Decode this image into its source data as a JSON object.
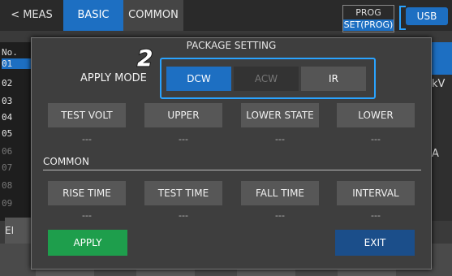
{
  "topbar": {
    "meas_label": "< MEAS",
    "basic_label": "BASIC",
    "common_label": "COMMON",
    "prog_label": "PROG",
    "set_label": "SET(PROG)",
    "usb_label": "USB"
  },
  "background": {
    "no_header": "No.",
    "rows": [
      "01",
      "02",
      "03",
      "04",
      "05",
      "06",
      "07",
      "08",
      "09"
    ],
    "kv_unit": "kV",
    "a_unit": "A",
    "el_label": "EI"
  },
  "dialog": {
    "title": "PACKAGE SETTING",
    "step_number": "2",
    "apply_mode_label": "APPLY MODE",
    "modes": [
      {
        "label": "DCW",
        "selected": true,
        "enabled": true
      },
      {
        "label": "ACW",
        "selected": false,
        "enabled": false
      },
      {
        "label": "IR",
        "selected": false,
        "enabled": true
      }
    ],
    "row1": [
      {
        "label": "TEST VOLT",
        "value": "---"
      },
      {
        "label": "UPPER",
        "value": "---"
      },
      {
        "label": "LOWER STATE",
        "value": "---"
      },
      {
        "label": "LOWER",
        "value": "---"
      }
    ],
    "common_section_label": "COMMON",
    "row2": [
      {
        "label": "RISE TIME",
        "value": "---"
      },
      {
        "label": "TEST TIME",
        "value": "---"
      },
      {
        "label": "FALL TIME",
        "value": "---"
      },
      {
        "label": "INTERVAL",
        "value": "---"
      }
    ],
    "apply_label": "APPLY",
    "exit_label": "EXIT"
  },
  "colors": {
    "accent": "#1d6fc2",
    "highlight": "#2aa3ff",
    "apply": "#1e9e4c",
    "exit": "#1b4e8a"
  }
}
